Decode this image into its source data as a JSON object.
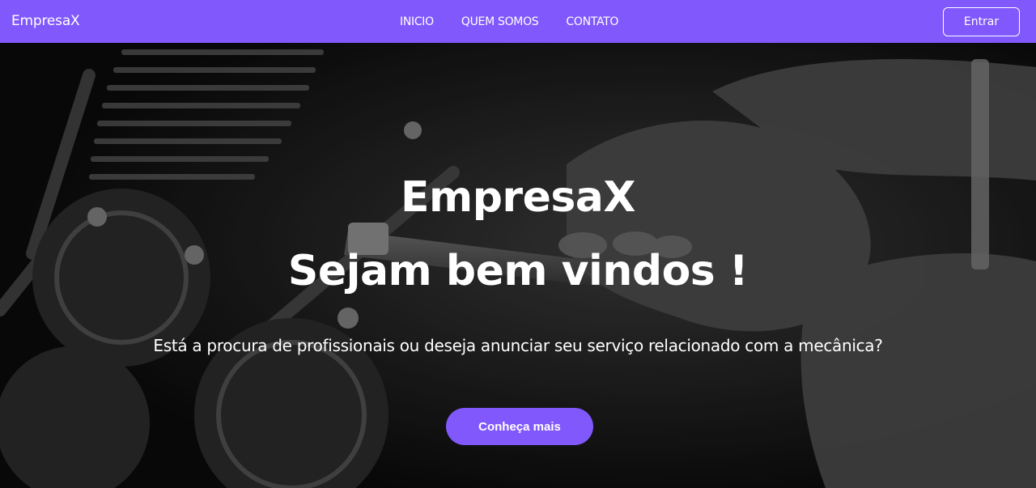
{
  "navbar": {
    "brand": "EmpresaX",
    "links": [
      {
        "label": "INICIO"
      },
      {
        "label": "QUEM SOMOS"
      },
      {
        "label": "CONTATO"
      }
    ],
    "login_label": "Entrar",
    "bg_color": "#8158fc"
  },
  "hero": {
    "title_line1": "EmpresaX",
    "title_line2": "Sejam bem vindos !",
    "subtitle": "Está a procura de profissionais ou deseja anunciar seu serviço relacionado com a mecânica?",
    "cta_label": "Conheça mais",
    "background_image": "grayscale photo of hands working on a motorcycle engine with a wrench"
  }
}
